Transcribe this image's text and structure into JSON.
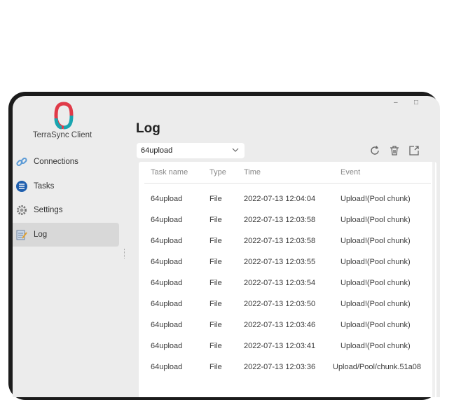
{
  "app": {
    "name": "TerraSync Client"
  },
  "window_controls": {
    "minimize": "–",
    "maximize": "□"
  },
  "sidebar": {
    "items": [
      {
        "label": "Connections",
        "icon": "link-icon",
        "active": false
      },
      {
        "label": "Tasks",
        "icon": "list-icon",
        "active": false
      },
      {
        "label": "Settings",
        "icon": "gear-icon",
        "active": false
      },
      {
        "label": "Log",
        "icon": "log-icon",
        "active": true
      }
    ]
  },
  "page": {
    "title": "Log"
  },
  "task_select": {
    "value": "64upload"
  },
  "toolbar": {
    "icons": [
      "refresh-icon",
      "trash-icon",
      "export-icon"
    ]
  },
  "table": {
    "headers": [
      "Task name",
      "Type",
      "Time",
      "Event"
    ],
    "rows": [
      {
        "task": "64upload",
        "type": "File",
        "time": "2022-07-13 12:04:04",
        "event": "Upload!(Pool chunk)"
      },
      {
        "task": "64upload",
        "type": "File",
        "time": "2022-07-13 12:03:58",
        "event": "Upload!(Pool chunk)"
      },
      {
        "task": "64upload",
        "type": "File",
        "time": "2022-07-13 12:03:58",
        "event": "Upload!(Pool chunk)"
      },
      {
        "task": "64upload",
        "type": "File",
        "time": "2022-07-13 12:03:55",
        "event": "Upload!(Pool chunk)"
      },
      {
        "task": "64upload",
        "type": "File",
        "time": "2022-07-13 12:03:54",
        "event": "Upload!(Pool chunk)"
      },
      {
        "task": "64upload",
        "type": "File",
        "time": "2022-07-13 12:03:50",
        "event": "Upload!(Pool chunk)"
      },
      {
        "task": "64upload",
        "type": "File",
        "time": "2022-07-13 12:03:46",
        "event": "Upload!(Pool chunk)"
      },
      {
        "task": "64upload",
        "type": "File",
        "time": "2022-07-13 12:03:41",
        "event": "Upload!(Pool chunk)"
      },
      {
        "task": "64upload",
        "type": "File",
        "time": "2022-07-13 12:03:36",
        "event": "Upload/Pool/chunk.51a08"
      }
    ]
  }
}
